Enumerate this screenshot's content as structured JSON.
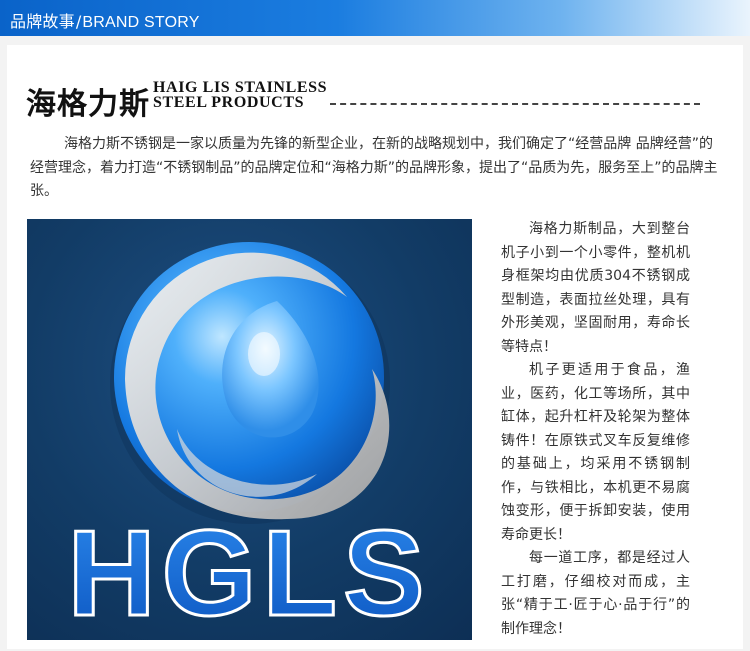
{
  "header": {
    "title_cn": "品牌故事",
    "separator": "/",
    "title_en": "BRAND STORY"
  },
  "brand": {
    "name_cn": "海格力斯",
    "name_en_line1": "HAIG LIS STAINLESS",
    "name_en_line2": "STEEL PRODUCTS"
  },
  "intro": "海格力斯不锈钢是一家以质量为先锋的新型企业，在新的战略规划中，我们确定了“经营品牌 品牌经营”的经营理念，着力打造“不锈钢制品”的品牌定位和“海格力斯”的品牌形象，提出了“品质为先，服务至上”的品牌主张。",
  "logo": {
    "text": "HGLS",
    "colors": {
      "background": "#123c66",
      "letters": "#1f6fd6",
      "ring": "#cfcfcf",
      "sphere": "#1a8cf0"
    }
  },
  "description": [
    "海格力斯制品，大到整台机子小到一个小零件，整机机身框架均由优质304不锈钢成型制造，表面拉丝处理，具有外形美观，坚固耐用，寿命长等特点！",
    "机子更适用于食品，渔业，医药，化工等场所，其中缸体，起升杠杆及轮架为整体铸件！在原铁式叉车反复维修的基础上，均采用不锈钢制作，与铁相比，本机更不易腐蚀变形，便于拆卸安装，使用寿命更长！",
    "每一道工序，都是经过人工打磨，仔细校对而成，主张“精于工·匠于心·品于行”的制作理念！"
  ]
}
